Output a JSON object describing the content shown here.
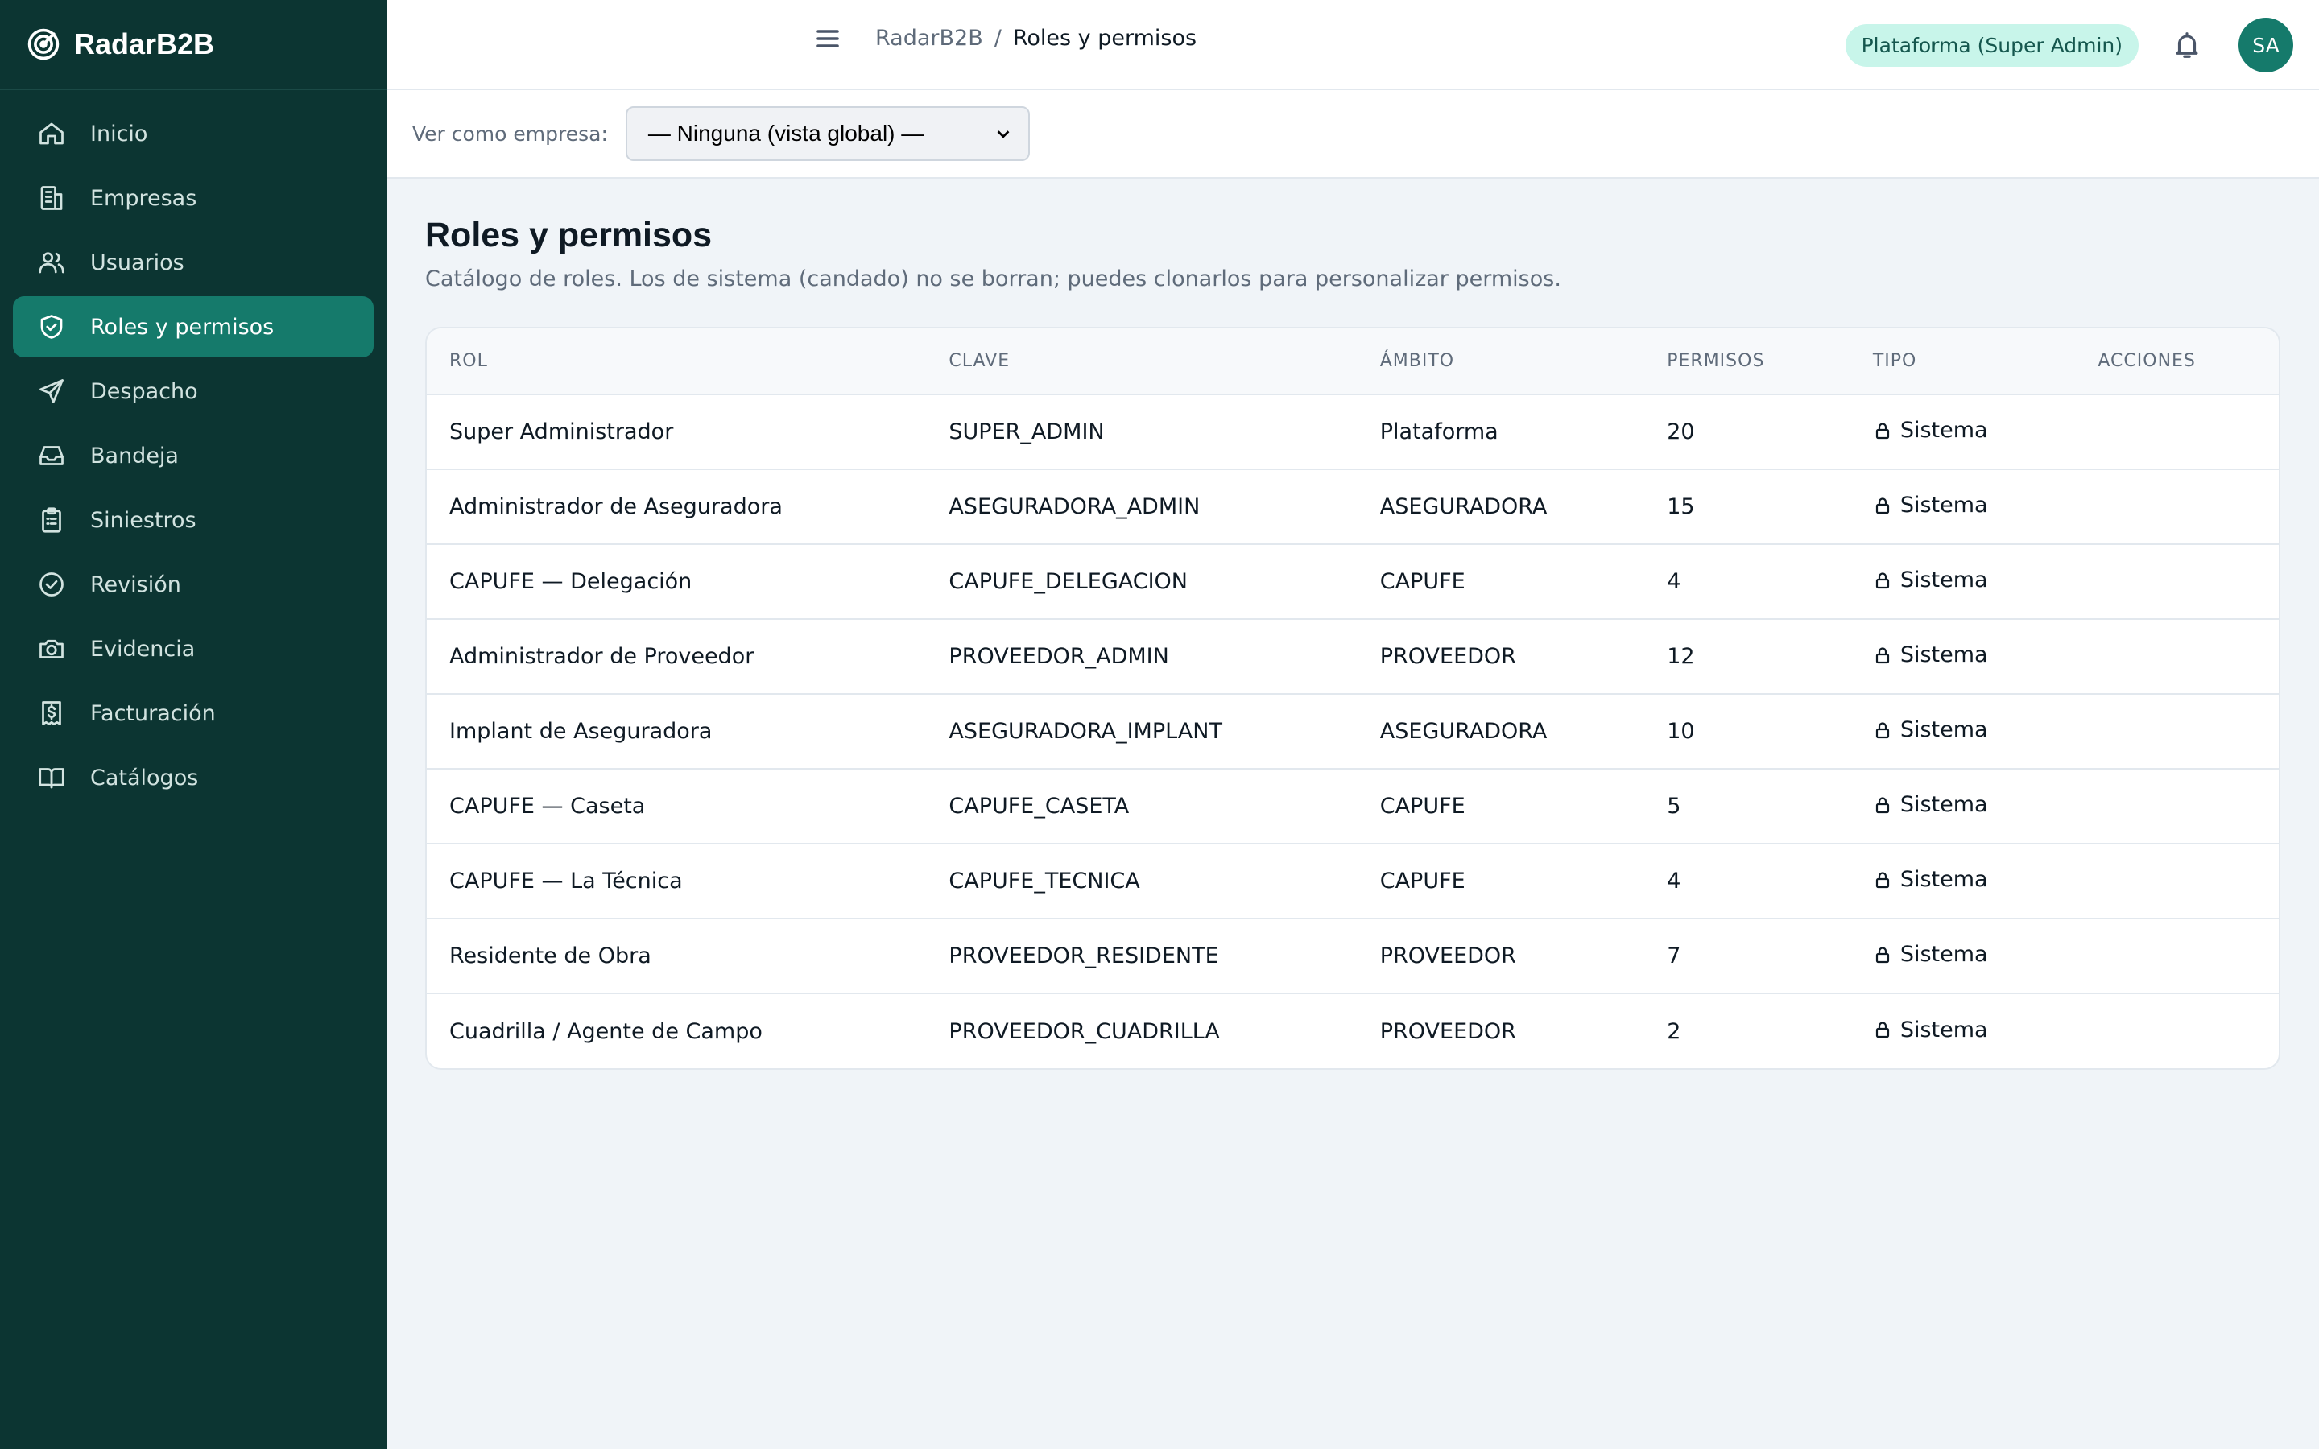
{
  "brand": {
    "name": "RadarB2B"
  },
  "sidebar": {
    "items": [
      {
        "label": "Inicio",
        "icon": "home-icon",
        "active": false
      },
      {
        "label": "Empresas",
        "icon": "building-icon",
        "active": false
      },
      {
        "label": "Usuarios",
        "icon": "users-icon",
        "active": false
      },
      {
        "label": "Roles y permisos",
        "icon": "shield-icon",
        "active": true
      },
      {
        "label": "Despacho",
        "icon": "send-icon",
        "active": false
      },
      {
        "label": "Bandeja",
        "icon": "inbox-icon",
        "active": false
      },
      {
        "label": "Siniestros",
        "icon": "clipboard-icon",
        "active": false
      },
      {
        "label": "Revisión",
        "icon": "check-circle-icon",
        "active": false
      },
      {
        "label": "Evidencia",
        "icon": "camera-icon",
        "active": false
      },
      {
        "label": "Facturación",
        "icon": "receipt-icon",
        "active": false
      },
      {
        "label": "Catálogos",
        "icon": "book-icon",
        "active": false
      }
    ]
  },
  "header": {
    "breadcrumb_root": "RadarB2B",
    "breadcrumb_sep": "/",
    "breadcrumb_current": "Roles y permisos",
    "platform_badge": "Plataforma (Super Admin)",
    "avatar_initials": "SA"
  },
  "filter": {
    "label": "Ver como empresa:",
    "selected": "— Ninguna (vista global) —"
  },
  "page": {
    "title": "Roles y permisos",
    "subtitle": "Catálogo de roles. Los de sistema (candado) no se borran; puedes clonarlos para personalizar permisos."
  },
  "table": {
    "columns": [
      "ROL",
      "CLAVE",
      "ÁMBITO",
      "PERMISOS",
      "TIPO",
      "ACCIONES"
    ],
    "rows": [
      {
        "rol": "Super Administrador",
        "clave": "SUPER_ADMIN",
        "ambito": "Plataforma",
        "permisos": "20",
        "tipo": "Sistema"
      },
      {
        "rol": "Administrador de Aseguradora",
        "clave": "ASEGURADORA_ADMIN",
        "ambito": "ASEGURADORA",
        "permisos": "15",
        "tipo": "Sistema"
      },
      {
        "rol": "CAPUFE — Delegación",
        "clave": "CAPUFE_DELEGACION",
        "ambito": "CAPUFE",
        "permisos": "4",
        "tipo": "Sistema"
      },
      {
        "rol": "Administrador de Proveedor",
        "clave": "PROVEEDOR_ADMIN",
        "ambito": "PROVEEDOR",
        "permisos": "12",
        "tipo": "Sistema"
      },
      {
        "rol": "Implant de Aseguradora",
        "clave": "ASEGURADORA_IMPLANT",
        "ambito": "ASEGURADORA",
        "permisos": "10",
        "tipo": "Sistema"
      },
      {
        "rol": "CAPUFE — Caseta",
        "clave": "CAPUFE_CASETA",
        "ambito": "CAPUFE",
        "permisos": "5",
        "tipo": "Sistema"
      },
      {
        "rol": "CAPUFE — La Técnica",
        "clave": "CAPUFE_TECNICA",
        "ambito": "CAPUFE",
        "permisos": "4",
        "tipo": "Sistema"
      },
      {
        "rol": "Residente de Obra",
        "clave": "PROVEEDOR_RESIDENTE",
        "ambito": "PROVEEDOR",
        "permisos": "7",
        "tipo": "Sistema"
      },
      {
        "rol": "Cuadrilla / Agente de Campo",
        "clave": "PROVEEDOR_CUADRILLA",
        "ambito": "PROVEEDOR",
        "permisos": "2",
        "tipo": "Sistema"
      }
    ]
  },
  "colors": {
    "sidebar_bg": "#0c3532",
    "accent": "#157a6b",
    "badge_bg": "#c8f5ea",
    "page_bg": "#f0f4f8"
  }
}
